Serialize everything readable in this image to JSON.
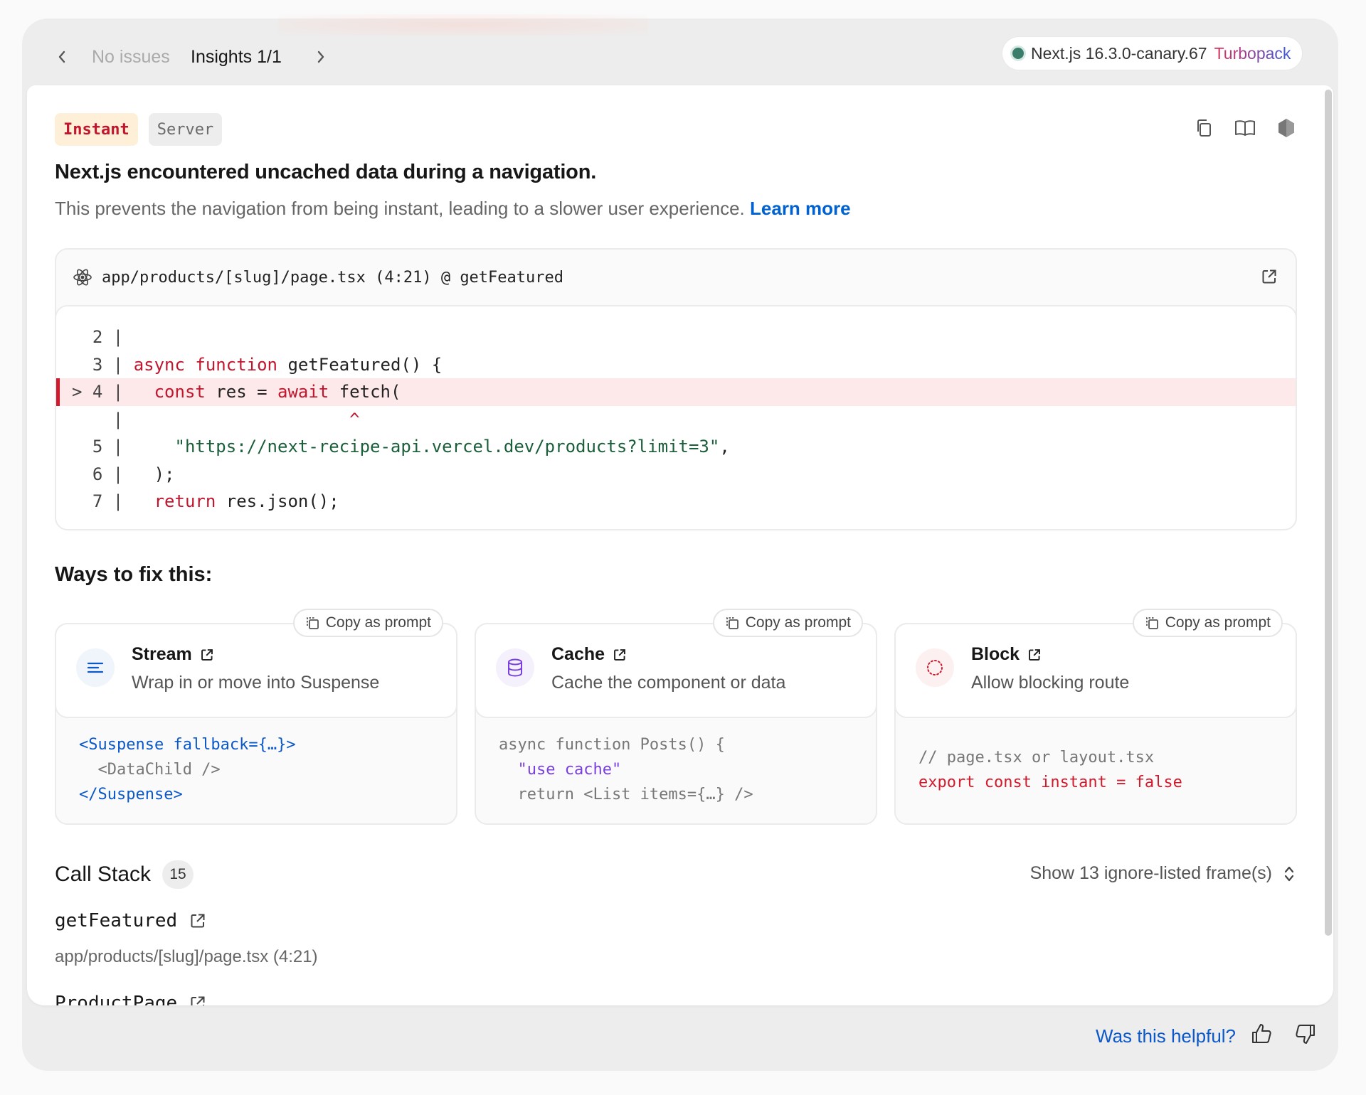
{
  "nav": {
    "no_issues": "No issues",
    "insights": "Insights 1/1",
    "version": "Next.js 16.3.0-canary.67",
    "bundler": "Turbopack"
  },
  "badges": {
    "instant": "Instant",
    "server": "Server"
  },
  "header": {
    "title": "Next.js encountered uncached data during a navigation.",
    "subtitle": "This prevents the navigation from being instant, leading to a slower user experience.",
    "learn_more": "Learn more"
  },
  "code_frame": {
    "file": "app/products/[slug]/page.tsx (4:21) @ getFeatured",
    "lines": [
      {
        "gutter": "  2 | ",
        "parts": []
      },
      {
        "gutter": "  3 | ",
        "parts": [
          [
            "k",
            "async"
          ],
          [
            "t",
            " "
          ],
          [
            "k",
            "function"
          ],
          [
            "t",
            " getFeatured() {"
          ]
        ]
      },
      {
        "gutter": "> 4 | ",
        "highlight": true,
        "parts": [
          [
            "t",
            "  "
          ],
          [
            "k",
            "const"
          ],
          [
            "t",
            " res = "
          ],
          [
            "k",
            "await"
          ],
          [
            "t",
            " fetch("
          ]
        ]
      },
      {
        "gutter": "    | ",
        "parts": [
          [
            "t",
            "                     "
          ],
          [
            "caret",
            "^"
          ]
        ]
      },
      {
        "gutter": "  5 | ",
        "parts": [
          [
            "t",
            "    "
          ],
          [
            "s",
            "\"https://next-recipe-api.vercel.dev/products?limit=3\""
          ],
          [
            "t",
            ","
          ]
        ]
      },
      {
        "gutter": "  6 | ",
        "parts": [
          [
            "t",
            "  );"
          ]
        ]
      },
      {
        "gutter": "  7 | ",
        "parts": [
          [
            "t",
            "  "
          ],
          [
            "k",
            "return"
          ],
          [
            "t",
            " res.json();"
          ]
        ]
      }
    ]
  },
  "ways": {
    "title": "Ways to fix this:",
    "copy_label": "Copy as prompt",
    "options": [
      {
        "name": "Stream",
        "desc": "Wrap in or move into Suspense",
        "icon": "stream-icon",
        "code": [
          [
            [
              "c-blue",
              "<Suspense fallback={…}>"
            ]
          ],
          [
            [
              "t",
              "  <DataChild />"
            ]
          ],
          [
            [
              "c-blue",
              "</Suspense>"
            ]
          ]
        ]
      },
      {
        "name": "Cache",
        "desc": "Cache the component or data",
        "icon": "database-icon",
        "code": [
          [
            [
              "t",
              "async function Posts() {"
            ]
          ],
          [
            [
              "t",
              "  "
            ],
            [
              "c-purple",
              "\"use cache\""
            ]
          ],
          [
            [
              "t",
              "  return <List items={…} />"
            ]
          ]
        ]
      },
      {
        "name": "Block",
        "desc": "Allow blocking route",
        "icon": "loader-icon",
        "code": [
          [
            [
              "t",
              "// page.tsx or layout.tsx"
            ]
          ],
          [
            [
              "c-red",
              "export const instant = false"
            ]
          ]
        ]
      }
    ]
  },
  "call_stack": {
    "title": "Call Stack",
    "count": "15",
    "toggle": "Show 13 ignore-listed frame(s)",
    "frames": [
      {
        "name": "getFeatured",
        "location": "app/products/[slug]/page.tsx (4:21)"
      },
      {
        "name": "ProductPage",
        "location": ""
      }
    ]
  },
  "footer": {
    "helpful": "Was this helpful?"
  },
  "colors": {
    "accent_link": "#0062d1",
    "error_red": "#c0172e",
    "status_dot": "#3a7d6b"
  }
}
